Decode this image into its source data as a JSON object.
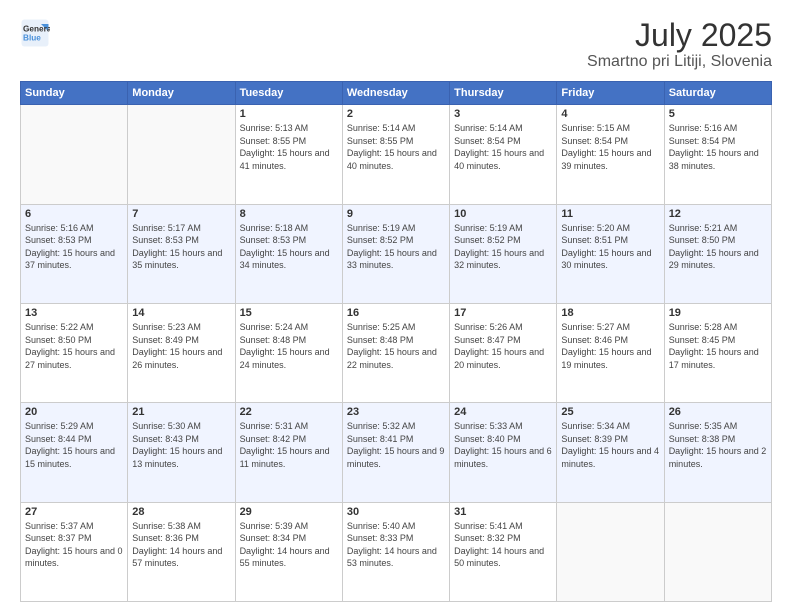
{
  "header": {
    "logo_line1": "General",
    "logo_line2": "Blue",
    "title": "July 2025",
    "subtitle": "Smartno pri Litiji, Slovenia"
  },
  "weekdays": [
    "Sunday",
    "Monday",
    "Tuesday",
    "Wednesday",
    "Thursday",
    "Friday",
    "Saturday"
  ],
  "weeks": [
    [
      {
        "day": "",
        "sunrise": "",
        "sunset": "",
        "daylight": ""
      },
      {
        "day": "",
        "sunrise": "",
        "sunset": "",
        "daylight": ""
      },
      {
        "day": "1",
        "sunrise": "Sunrise: 5:13 AM",
        "sunset": "Sunset: 8:55 PM",
        "daylight": "Daylight: 15 hours and 41 minutes."
      },
      {
        "day": "2",
        "sunrise": "Sunrise: 5:14 AM",
        "sunset": "Sunset: 8:55 PM",
        "daylight": "Daylight: 15 hours and 40 minutes."
      },
      {
        "day": "3",
        "sunrise": "Sunrise: 5:14 AM",
        "sunset": "Sunset: 8:54 PM",
        "daylight": "Daylight: 15 hours and 40 minutes."
      },
      {
        "day": "4",
        "sunrise": "Sunrise: 5:15 AM",
        "sunset": "Sunset: 8:54 PM",
        "daylight": "Daylight: 15 hours and 39 minutes."
      },
      {
        "day": "5",
        "sunrise": "Sunrise: 5:16 AM",
        "sunset": "Sunset: 8:54 PM",
        "daylight": "Daylight: 15 hours and 38 minutes."
      }
    ],
    [
      {
        "day": "6",
        "sunrise": "Sunrise: 5:16 AM",
        "sunset": "Sunset: 8:53 PM",
        "daylight": "Daylight: 15 hours and 37 minutes."
      },
      {
        "day": "7",
        "sunrise": "Sunrise: 5:17 AM",
        "sunset": "Sunset: 8:53 PM",
        "daylight": "Daylight: 15 hours and 35 minutes."
      },
      {
        "day": "8",
        "sunrise": "Sunrise: 5:18 AM",
        "sunset": "Sunset: 8:53 PM",
        "daylight": "Daylight: 15 hours and 34 minutes."
      },
      {
        "day": "9",
        "sunrise": "Sunrise: 5:19 AM",
        "sunset": "Sunset: 8:52 PM",
        "daylight": "Daylight: 15 hours and 33 minutes."
      },
      {
        "day": "10",
        "sunrise": "Sunrise: 5:19 AM",
        "sunset": "Sunset: 8:52 PM",
        "daylight": "Daylight: 15 hours and 32 minutes."
      },
      {
        "day": "11",
        "sunrise": "Sunrise: 5:20 AM",
        "sunset": "Sunset: 8:51 PM",
        "daylight": "Daylight: 15 hours and 30 minutes."
      },
      {
        "day": "12",
        "sunrise": "Sunrise: 5:21 AM",
        "sunset": "Sunset: 8:50 PM",
        "daylight": "Daylight: 15 hours and 29 minutes."
      }
    ],
    [
      {
        "day": "13",
        "sunrise": "Sunrise: 5:22 AM",
        "sunset": "Sunset: 8:50 PM",
        "daylight": "Daylight: 15 hours and 27 minutes."
      },
      {
        "day": "14",
        "sunrise": "Sunrise: 5:23 AM",
        "sunset": "Sunset: 8:49 PM",
        "daylight": "Daylight: 15 hours and 26 minutes."
      },
      {
        "day": "15",
        "sunrise": "Sunrise: 5:24 AM",
        "sunset": "Sunset: 8:48 PM",
        "daylight": "Daylight: 15 hours and 24 minutes."
      },
      {
        "day": "16",
        "sunrise": "Sunrise: 5:25 AM",
        "sunset": "Sunset: 8:48 PM",
        "daylight": "Daylight: 15 hours and 22 minutes."
      },
      {
        "day": "17",
        "sunrise": "Sunrise: 5:26 AM",
        "sunset": "Sunset: 8:47 PM",
        "daylight": "Daylight: 15 hours and 20 minutes."
      },
      {
        "day": "18",
        "sunrise": "Sunrise: 5:27 AM",
        "sunset": "Sunset: 8:46 PM",
        "daylight": "Daylight: 15 hours and 19 minutes."
      },
      {
        "day": "19",
        "sunrise": "Sunrise: 5:28 AM",
        "sunset": "Sunset: 8:45 PM",
        "daylight": "Daylight: 15 hours and 17 minutes."
      }
    ],
    [
      {
        "day": "20",
        "sunrise": "Sunrise: 5:29 AM",
        "sunset": "Sunset: 8:44 PM",
        "daylight": "Daylight: 15 hours and 15 minutes."
      },
      {
        "day": "21",
        "sunrise": "Sunrise: 5:30 AM",
        "sunset": "Sunset: 8:43 PM",
        "daylight": "Daylight: 15 hours and 13 minutes."
      },
      {
        "day": "22",
        "sunrise": "Sunrise: 5:31 AM",
        "sunset": "Sunset: 8:42 PM",
        "daylight": "Daylight: 15 hours and 11 minutes."
      },
      {
        "day": "23",
        "sunrise": "Sunrise: 5:32 AM",
        "sunset": "Sunset: 8:41 PM",
        "daylight": "Daylight: 15 hours and 9 minutes."
      },
      {
        "day": "24",
        "sunrise": "Sunrise: 5:33 AM",
        "sunset": "Sunset: 8:40 PM",
        "daylight": "Daylight: 15 hours and 6 minutes."
      },
      {
        "day": "25",
        "sunrise": "Sunrise: 5:34 AM",
        "sunset": "Sunset: 8:39 PM",
        "daylight": "Daylight: 15 hours and 4 minutes."
      },
      {
        "day": "26",
        "sunrise": "Sunrise: 5:35 AM",
        "sunset": "Sunset: 8:38 PM",
        "daylight": "Daylight: 15 hours and 2 minutes."
      }
    ],
    [
      {
        "day": "27",
        "sunrise": "Sunrise: 5:37 AM",
        "sunset": "Sunset: 8:37 PM",
        "daylight": "Daylight: 15 hours and 0 minutes."
      },
      {
        "day": "28",
        "sunrise": "Sunrise: 5:38 AM",
        "sunset": "Sunset: 8:36 PM",
        "daylight": "Daylight: 14 hours and 57 minutes."
      },
      {
        "day": "29",
        "sunrise": "Sunrise: 5:39 AM",
        "sunset": "Sunset: 8:34 PM",
        "daylight": "Daylight: 14 hours and 55 minutes."
      },
      {
        "day": "30",
        "sunrise": "Sunrise: 5:40 AM",
        "sunset": "Sunset: 8:33 PM",
        "daylight": "Daylight: 14 hours and 53 minutes."
      },
      {
        "day": "31",
        "sunrise": "Sunrise: 5:41 AM",
        "sunset": "Sunset: 8:32 PM",
        "daylight": "Daylight: 14 hours and 50 minutes."
      },
      {
        "day": "",
        "sunrise": "",
        "sunset": "",
        "daylight": ""
      },
      {
        "day": "",
        "sunrise": "",
        "sunset": "",
        "daylight": ""
      }
    ]
  ]
}
